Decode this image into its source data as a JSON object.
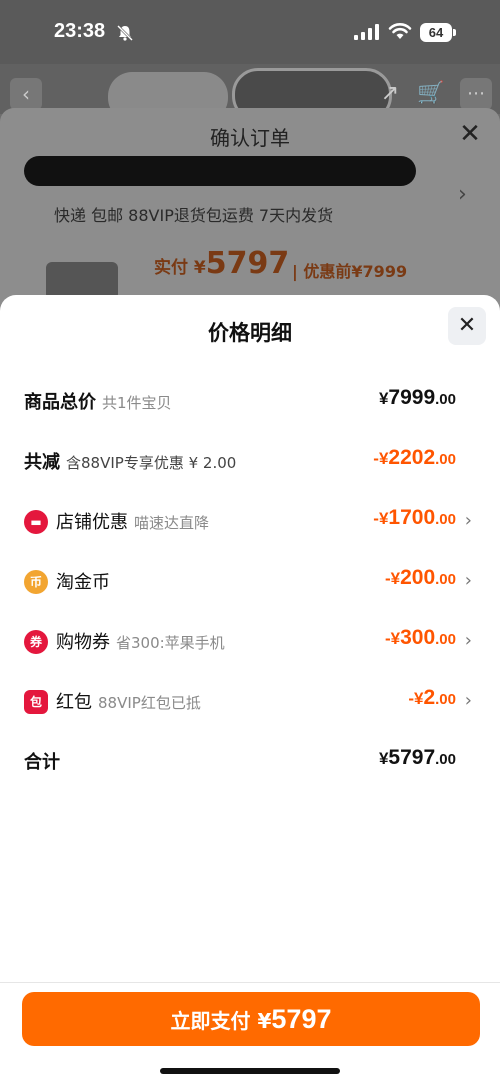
{
  "status_bar": {
    "time": "23:38",
    "battery": "64"
  },
  "confirm_order": {
    "title": "确认订单",
    "close": "✕",
    "shipping": "快递 包邮 88VIP退货包运费 7天内发货",
    "pay_prefix": "实付 ¥",
    "pay_amount": "5797",
    "original_price": "| 优惠前¥7999"
  },
  "price_detail": {
    "title": "价格明细",
    "close": "✕",
    "rows": [
      {
        "label": "商品总价",
        "sub": "共1件宝贝",
        "yen": "¥",
        "int": "7999",
        "dec": ".00"
      },
      {
        "label": "共减",
        "sub": "含88VIP专享优惠 ¥ 2.00",
        "yen": "-¥",
        "int": "2202",
        "dec": ".00"
      },
      {
        "label": "店铺优惠",
        "sub": "喵速达直降",
        "yen": "-¥",
        "int": "1700",
        "dec": ".00",
        "icon": "store-coupon-icon"
      },
      {
        "label": "淘金币",
        "sub": "",
        "yen": "-¥",
        "int": "200",
        "dec": ".00",
        "icon": "taojinbi-coin-icon"
      },
      {
        "label": "购物券",
        "sub": "省300:苹果手机",
        "yen": "-¥",
        "int": "300",
        "dec": ".00",
        "icon": "shopping-voucher-icon"
      },
      {
        "label": "红包",
        "sub": "88VIP红包已抵",
        "yen": "-¥",
        "int": "2",
        "dec": ".00",
        "icon": "red-packet-icon"
      },
      {
        "label": "合计",
        "sub": "",
        "yen": "¥",
        "int": "5797",
        "dec": ".00"
      }
    ]
  },
  "pay_button": {
    "label": "立即支付 ¥",
    "amount": "5797"
  },
  "colors": {
    "accent": "#ff6a00",
    "discount": "#ff5500",
    "icon_red": "#e4173d",
    "icon_gold": "#f2a531"
  }
}
